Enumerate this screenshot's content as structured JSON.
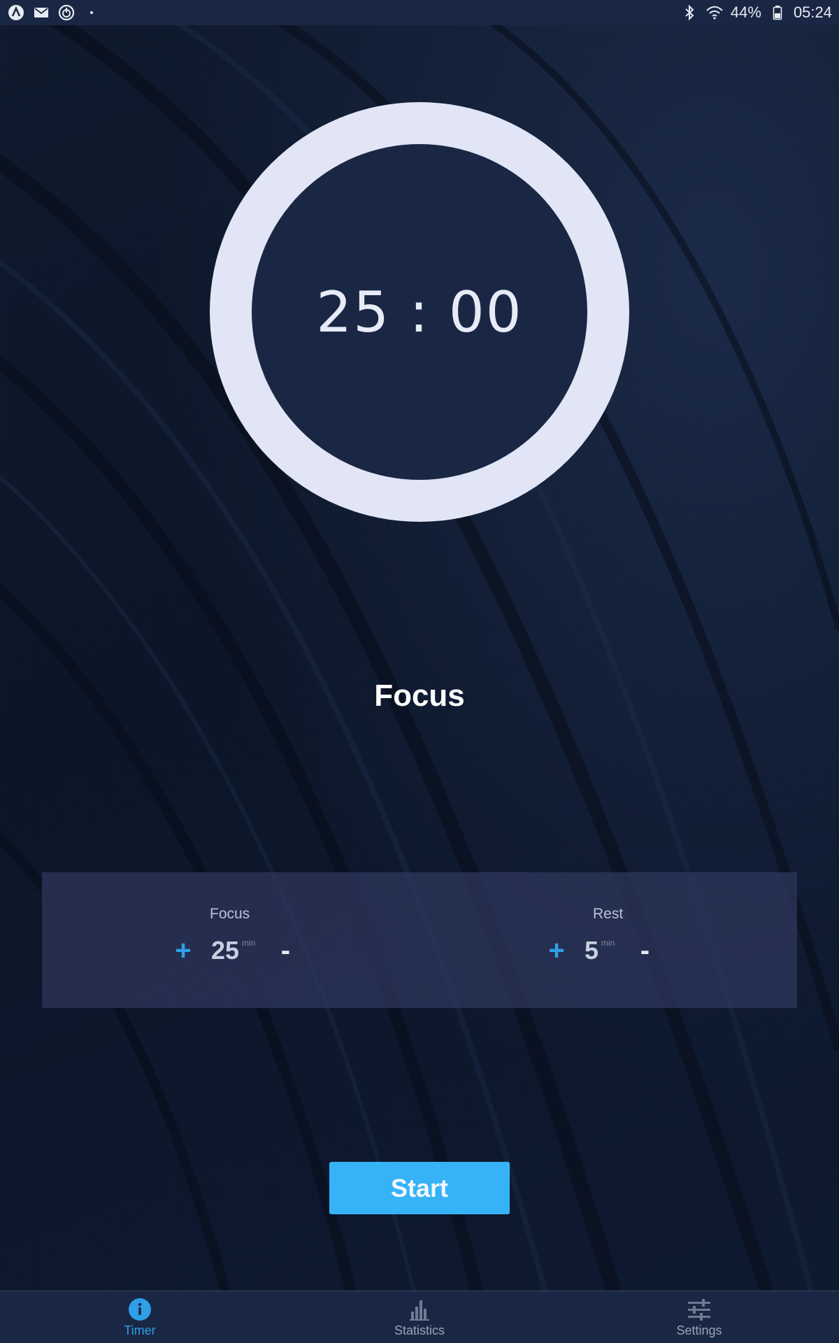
{
  "status_bar": {
    "battery_percent": "44%",
    "time": "05:24",
    "left_icons": [
      "app-logo-icon",
      "mail-icon",
      "power-timer-icon",
      "dot-icon"
    ],
    "right_icons": [
      "bluetooth-icon",
      "wifi-icon",
      "battery-icon"
    ]
  },
  "timer": {
    "display": "25 : 00",
    "ring_color": "#e1e5f5",
    "inner_color": "#1a2744"
  },
  "mode_label": "Focus",
  "settings": {
    "focus": {
      "title": "Focus",
      "value": "25",
      "unit": "min",
      "plus_label": "+",
      "minus_label": "-"
    },
    "rest": {
      "title": "Rest",
      "value": "5",
      "unit": "min",
      "plus_label": "+",
      "minus_label": "-"
    }
  },
  "start_button": {
    "label": "Start",
    "color": "#36b3f6"
  },
  "bottom_nav": {
    "items": [
      {
        "label": "Timer",
        "icon": "info-icon",
        "active": true
      },
      {
        "label": "Statistics",
        "icon": "bar-chart-icon",
        "active": false
      },
      {
        "label": "Settings",
        "icon": "sliders-icon",
        "active": false
      }
    ],
    "active_color": "#2f9fe8"
  }
}
